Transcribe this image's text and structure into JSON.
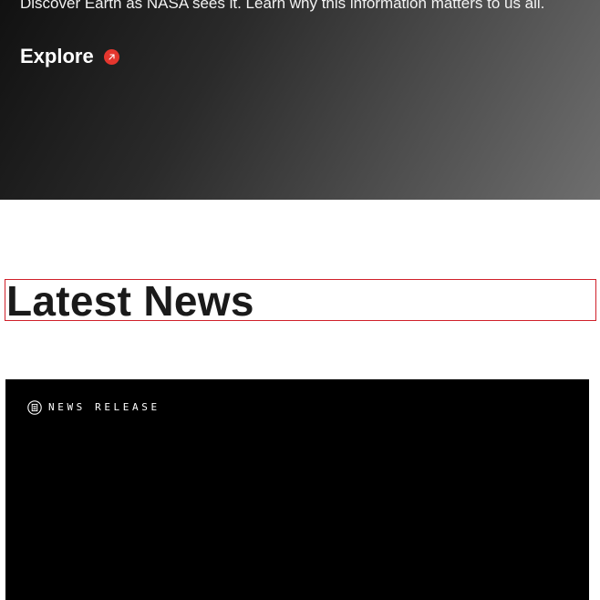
{
  "hero": {
    "description": "Discover Earth as NASA sees it. Learn why this information matters to us all.",
    "cta_label": "Explore",
    "cta_icon": "arrow-up-right-icon",
    "accent_color": "#e4362e"
  },
  "latest_news": {
    "title": "Latest News",
    "cards": [
      {
        "tag_icon": "document-icon",
        "tag_label": "NEWS RELEASE"
      }
    ]
  }
}
